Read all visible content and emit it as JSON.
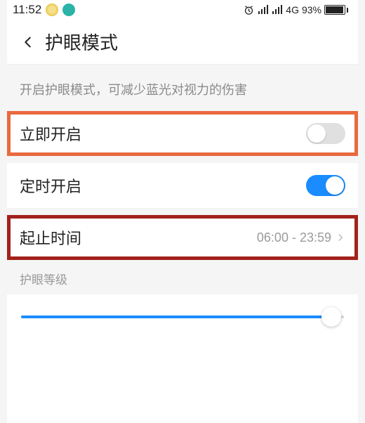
{
  "status_bar": {
    "time": "11:52",
    "network_label": "4G",
    "battery_percent": "93%"
  },
  "header": {
    "title": "护眼模式"
  },
  "description": "开启护眼模式，可减少蓝光对视力的伤害",
  "rows": {
    "enable_now": {
      "label": "立即开启",
      "on": false
    },
    "scheduled": {
      "label": "定时开启",
      "on": true
    },
    "time_range": {
      "label": "起止时间",
      "value": "06:00 - 23:59"
    }
  },
  "level": {
    "header": "护眼等级",
    "value_percent": 96
  }
}
